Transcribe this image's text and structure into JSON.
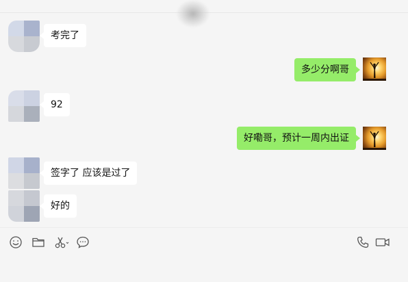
{
  "messages": [
    {
      "direction": "in",
      "text": "考完了"
    },
    {
      "direction": "out",
      "text": "多少分啊哥"
    },
    {
      "direction": "in",
      "text": "92"
    },
    {
      "direction": "out",
      "text": "好嘞哥，预计一周内出证"
    },
    {
      "direction": "in",
      "text": "签字了  应该是过了"
    },
    {
      "direction": "in",
      "text": "好的"
    }
  ],
  "colors": {
    "outgoing_bubble": "#95ec69",
    "incoming_bubble": "#ffffff",
    "background": "#f5f5f5",
    "icon_stroke": "#555555"
  },
  "toolbar": {
    "left_icons": [
      "emoji-icon",
      "folder-icon",
      "scissors-icon",
      "chat-bubble-icon"
    ],
    "right_icons": [
      "phone-icon",
      "video-icon"
    ]
  }
}
